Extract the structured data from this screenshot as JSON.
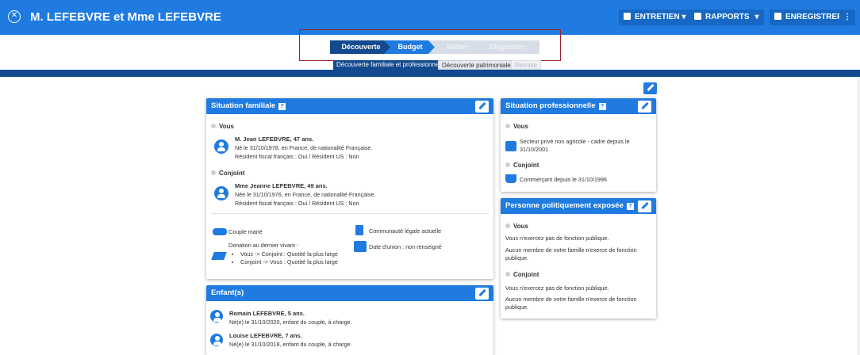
{
  "header": {
    "title": "M. LEFEBVRE et Mme LEFEBVRE",
    "buttons": {
      "entretien": "ENTRETIEN",
      "rapports": "RAPPORTS",
      "enregistrer": "ENREGISTRER"
    }
  },
  "steps": [
    "Découverte",
    "Budget",
    "Métier",
    "Diagnostic"
  ],
  "subtabs": [
    "Découverte familiale et professionnelle",
    "Découverte patrimoniale",
    "Retraite"
  ],
  "familiale": {
    "title": "Situation familiale",
    "vous_label": "Vous",
    "vous_name": "M. Jean LEFEBVRE, 47 ans.",
    "vous_line1": "Né le 31/10/1978, en France, de nationalité Française.",
    "vous_line2": "Résident fiscal français : Oui / Résident US : Non",
    "conjoint_label": "Conjoint",
    "conjoint_name": "Mme Jeanne LEFEBVRE, 49 ans.",
    "conjoint_line1": "Née le 31/10/1976, en France, de nationalité Française.",
    "conjoint_line2": "Résident fiscal français : Oui / Résident US : Non",
    "couple": "Couple marié",
    "regime": "Communauté légale actuelle",
    "donation_title": "Donation au dernier vivant :",
    "donation_items": [
      "Vous -> Conjoint : Quotité la plus large",
      "Conjoint -> Vous : Quotité la plus large"
    ],
    "union": "Date d'union : non renseigné"
  },
  "enfants": {
    "title": "Enfant(s)",
    "items": [
      {
        "name": "Romain LEFEBVRE, 5 ans.",
        "detail": "Né(e) le 31/10/2020, enfant du couple, à charge."
      },
      {
        "name": "Louise LEFEBVRE, 7 ans.",
        "detail": "Né(e) le 31/10/2018, enfant du couple, à charge."
      }
    ]
  },
  "pro": {
    "title": "Situation professionnelle",
    "vous_label": "Vous",
    "vous_text": "Secteur privé non agricole - cadre depuis le 31/10/2001",
    "conjoint_label": "Conjoint",
    "conjoint_text": "Commerçant depuis le 31/10/1996"
  },
  "ppe": {
    "title": "Personne politiquement exposée",
    "vous_label": "Vous",
    "vous_line1": "Vous n'exercez pas de fonction publique.",
    "vous_line2": "Aucun membre de votre famille n'exerce de fonction publique.",
    "conjoint_label": "Conjoint",
    "conjoint_line1": "Vous n'exercez pas de fonction publique.",
    "conjoint_line2": "Aucun membre de votre famille n'exerce de fonction publique."
  },
  "icons": {
    "close": "close-circle-icon",
    "edit": "edit-pencil-icon",
    "person": "person-icon",
    "couple": "couple-icon",
    "document": "document-icon",
    "calendar": "calendar-icon",
    "cart": "cart-icon",
    "help": "help-icon"
  },
  "colors": {
    "primary": "#1f7be0",
    "dark": "#13498f",
    "stepper_highlight": "#9b2335"
  }
}
